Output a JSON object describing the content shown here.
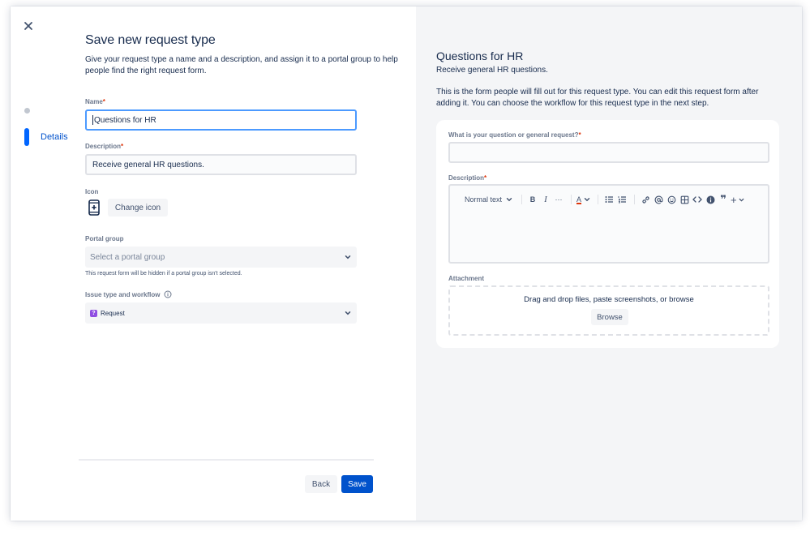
{
  "wizard": {
    "steps": [
      {
        "label": ""
      },
      {
        "label": "Details"
      }
    ]
  },
  "form": {
    "title": "Save new request type",
    "subtitle": "Give your request type a name and a description, and assign it to a portal group to help people find the right request form.",
    "name": {
      "label": "Name",
      "required_mark": "*",
      "value": "Questions for HR"
    },
    "description": {
      "label": "Description",
      "required_mark": "*",
      "value": "Receive general HR questions."
    },
    "icon": {
      "label": "Icon",
      "icon_name": "mobile-device-icon",
      "button_label": "Change icon"
    },
    "portal_group": {
      "label": "Portal group",
      "placeholder": "Select a portal group",
      "helper": "This request form will be hidden if a portal group isn't selected."
    },
    "issue_type": {
      "label": "Issue type and workflow",
      "badge": "?",
      "value": "Request"
    },
    "buttons": {
      "back": "Back",
      "save": "Save"
    }
  },
  "preview": {
    "title": "Questions for HR",
    "subtitle": "Receive general HR questions.",
    "description": "This is the form people will fill out for this request type. You can edit this request form after adding it. You can choose the workflow for this request type in the next step.",
    "question_label": "What is your question or general request?",
    "required_mark": "*",
    "description_label": "Description",
    "toolbar": {
      "text_style": "Normal text",
      "bold": "B",
      "italic": "I",
      "more": "···",
      "color": "A",
      "quote": "❞",
      "plus": "+"
    },
    "attachment_label": "Attachment",
    "attachment_text": "Drag and drop files, paste screenshots, or browse",
    "browse_label": "Browse"
  },
  "colors": {
    "brand": "#0052cc",
    "accent": "#0065ff",
    "required": "#de350b",
    "panel_bg": "#f4f5f7"
  }
}
